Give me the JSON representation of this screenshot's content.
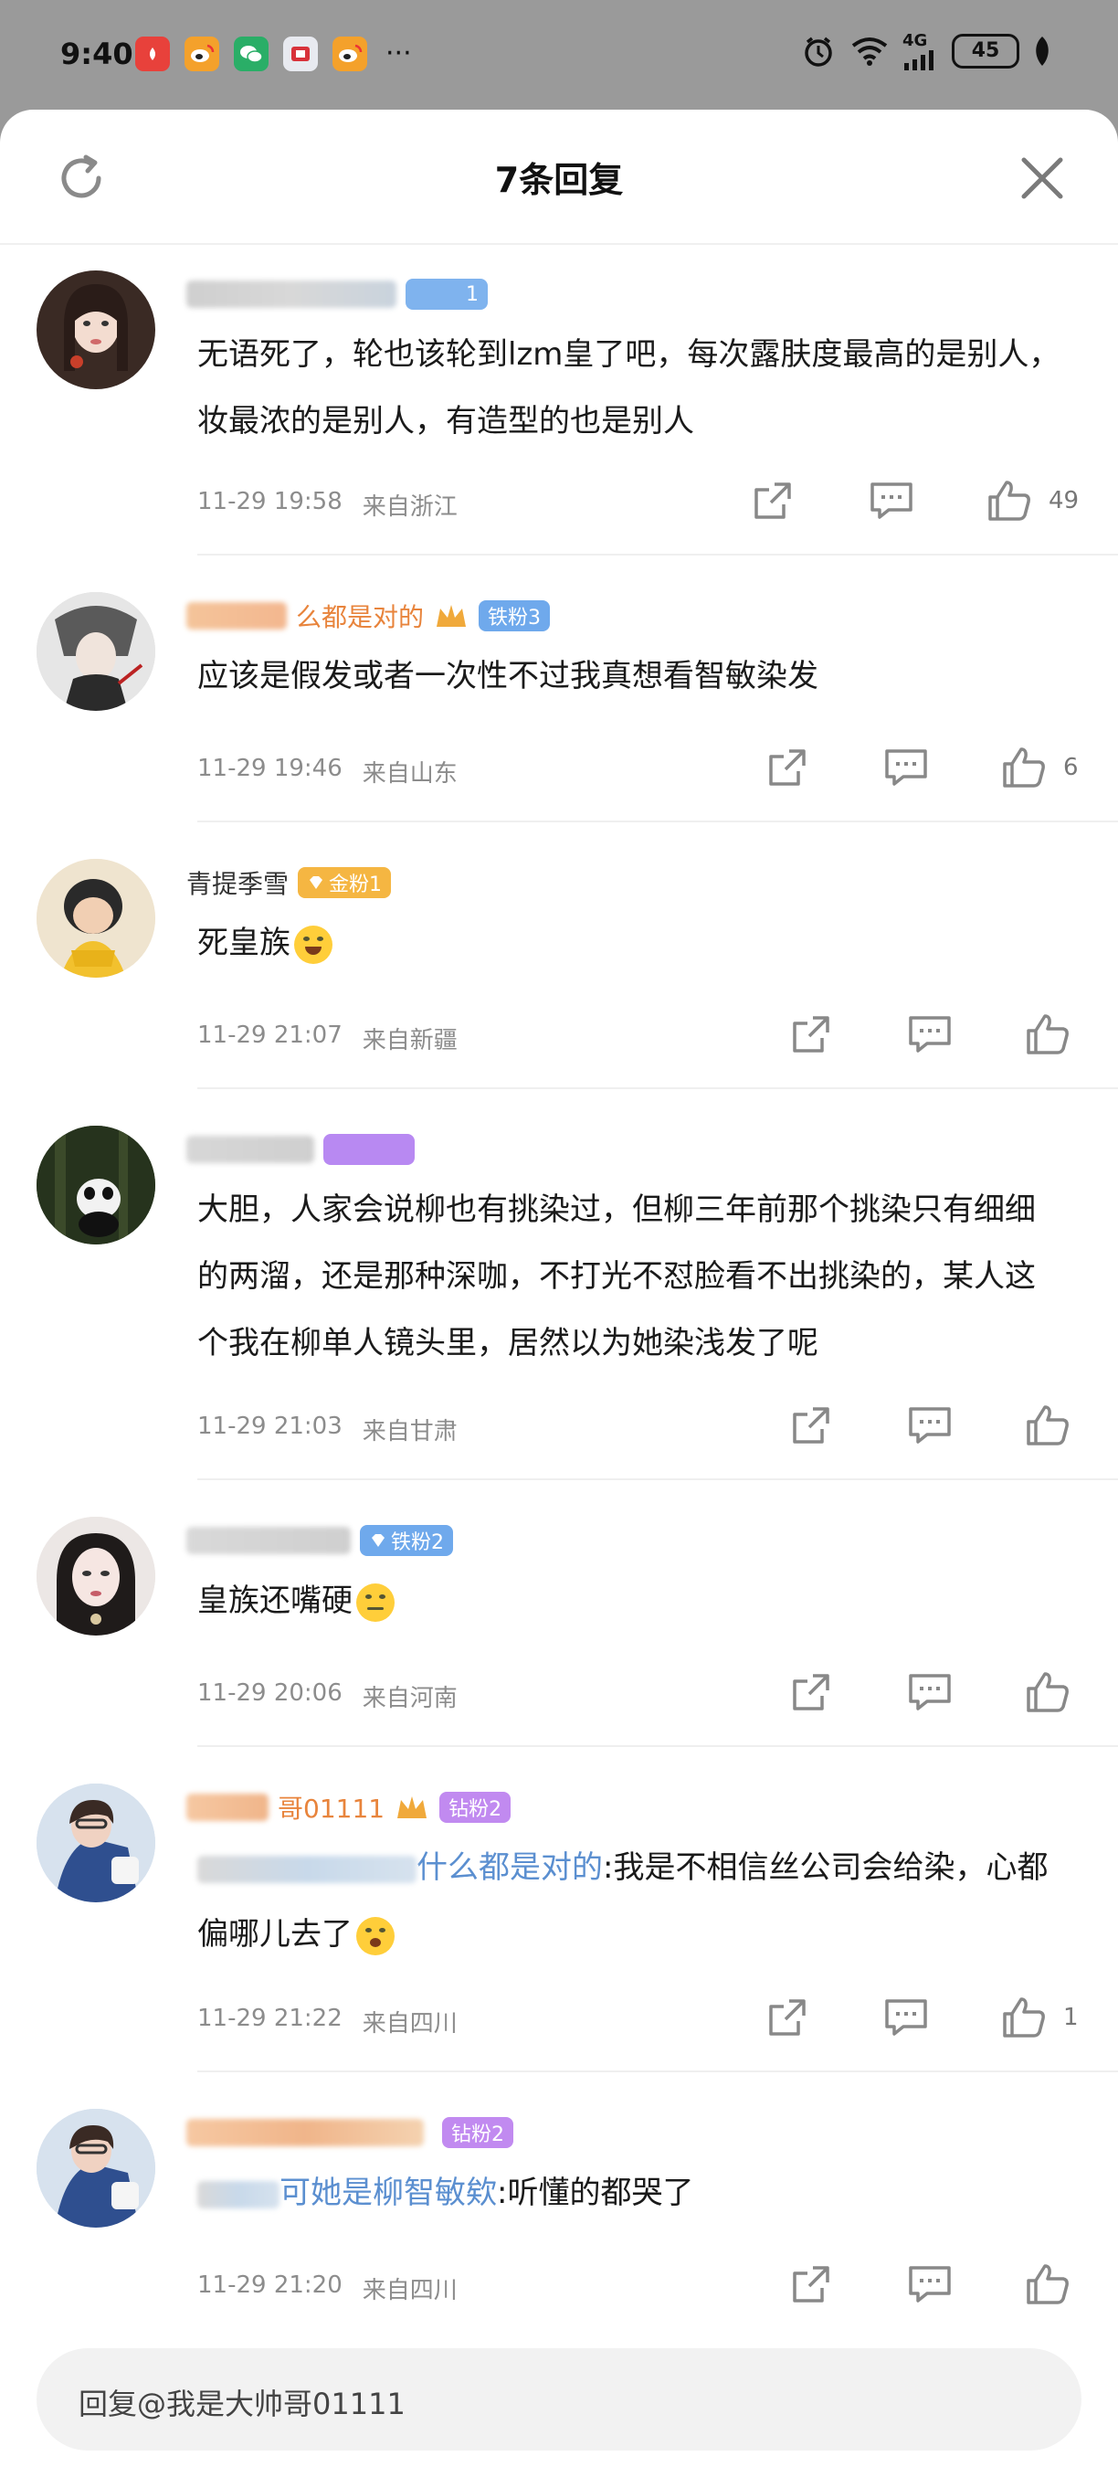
{
  "status_bar": {
    "time": "9:40",
    "network": "4G",
    "battery": "45"
  },
  "header": {
    "title": "7条回复"
  },
  "replies": [
    {
      "badge": "1",
      "content": "无语死了，轮也该轮到lzm皇了吧，每次露肤度最高的是别人，妆最浓的是别人，有造型的也是别人",
      "date": "11-29 19:58",
      "location": "来自浙江",
      "likes": "49"
    },
    {
      "name_fragment": "么都是对的",
      "badge": "铁粉3",
      "content": "应该是假发或者一次性不过我真想看智敏染发",
      "date": "11-29 19:46",
      "location": "来自山东",
      "likes": "6"
    },
    {
      "name_fragment": "青提季雪",
      "badge": "金粉1",
      "content": "死皇族",
      "date": "11-29 21:07",
      "location": "来自新疆",
      "likes": ""
    },
    {
      "badge": "",
      "content": "大胆，人家会说柳也有挑染过，但柳三年前那个挑染只有细细的两溜，还是那种深咖，不打光不怼脸看不出挑染的，某人这个我在柳单人镜头里，居然以为她染浅发了呢",
      "date": "11-29 21:03",
      "location": "来自甘肃",
      "likes": ""
    },
    {
      "badge": "铁粉2",
      "content": "皇族还嘴硬",
      "date": "11-29 20:06",
      "location": "来自河南",
      "likes": ""
    },
    {
      "name_fragment": "哥01111",
      "badge": "钻粉2",
      "quote_fragment": "什么都是对的",
      "content": ":我是不相信丝公司会给染，心都偏哪儿去了",
      "date": "11-29 21:22",
      "location": "来自四川",
      "likes": "1"
    },
    {
      "name_fragment": "",
      "badge": "钻粉2",
      "quote_fragment": "可她是柳智敏欸",
      "content": ":听懂的都哭了",
      "date": "11-29 21:20",
      "location": "来自四川",
      "likes": ""
    }
  ],
  "reply_input": {
    "placeholder": "回复@我是大帅哥01111"
  },
  "colors": {
    "badge_blue": "#7fb3ee",
    "badge_iron": "#6fa9ec",
    "badge_gold": "#f5b642",
    "badge_purple": "#b889f2",
    "badge_diamond": "#c18af0"
  }
}
